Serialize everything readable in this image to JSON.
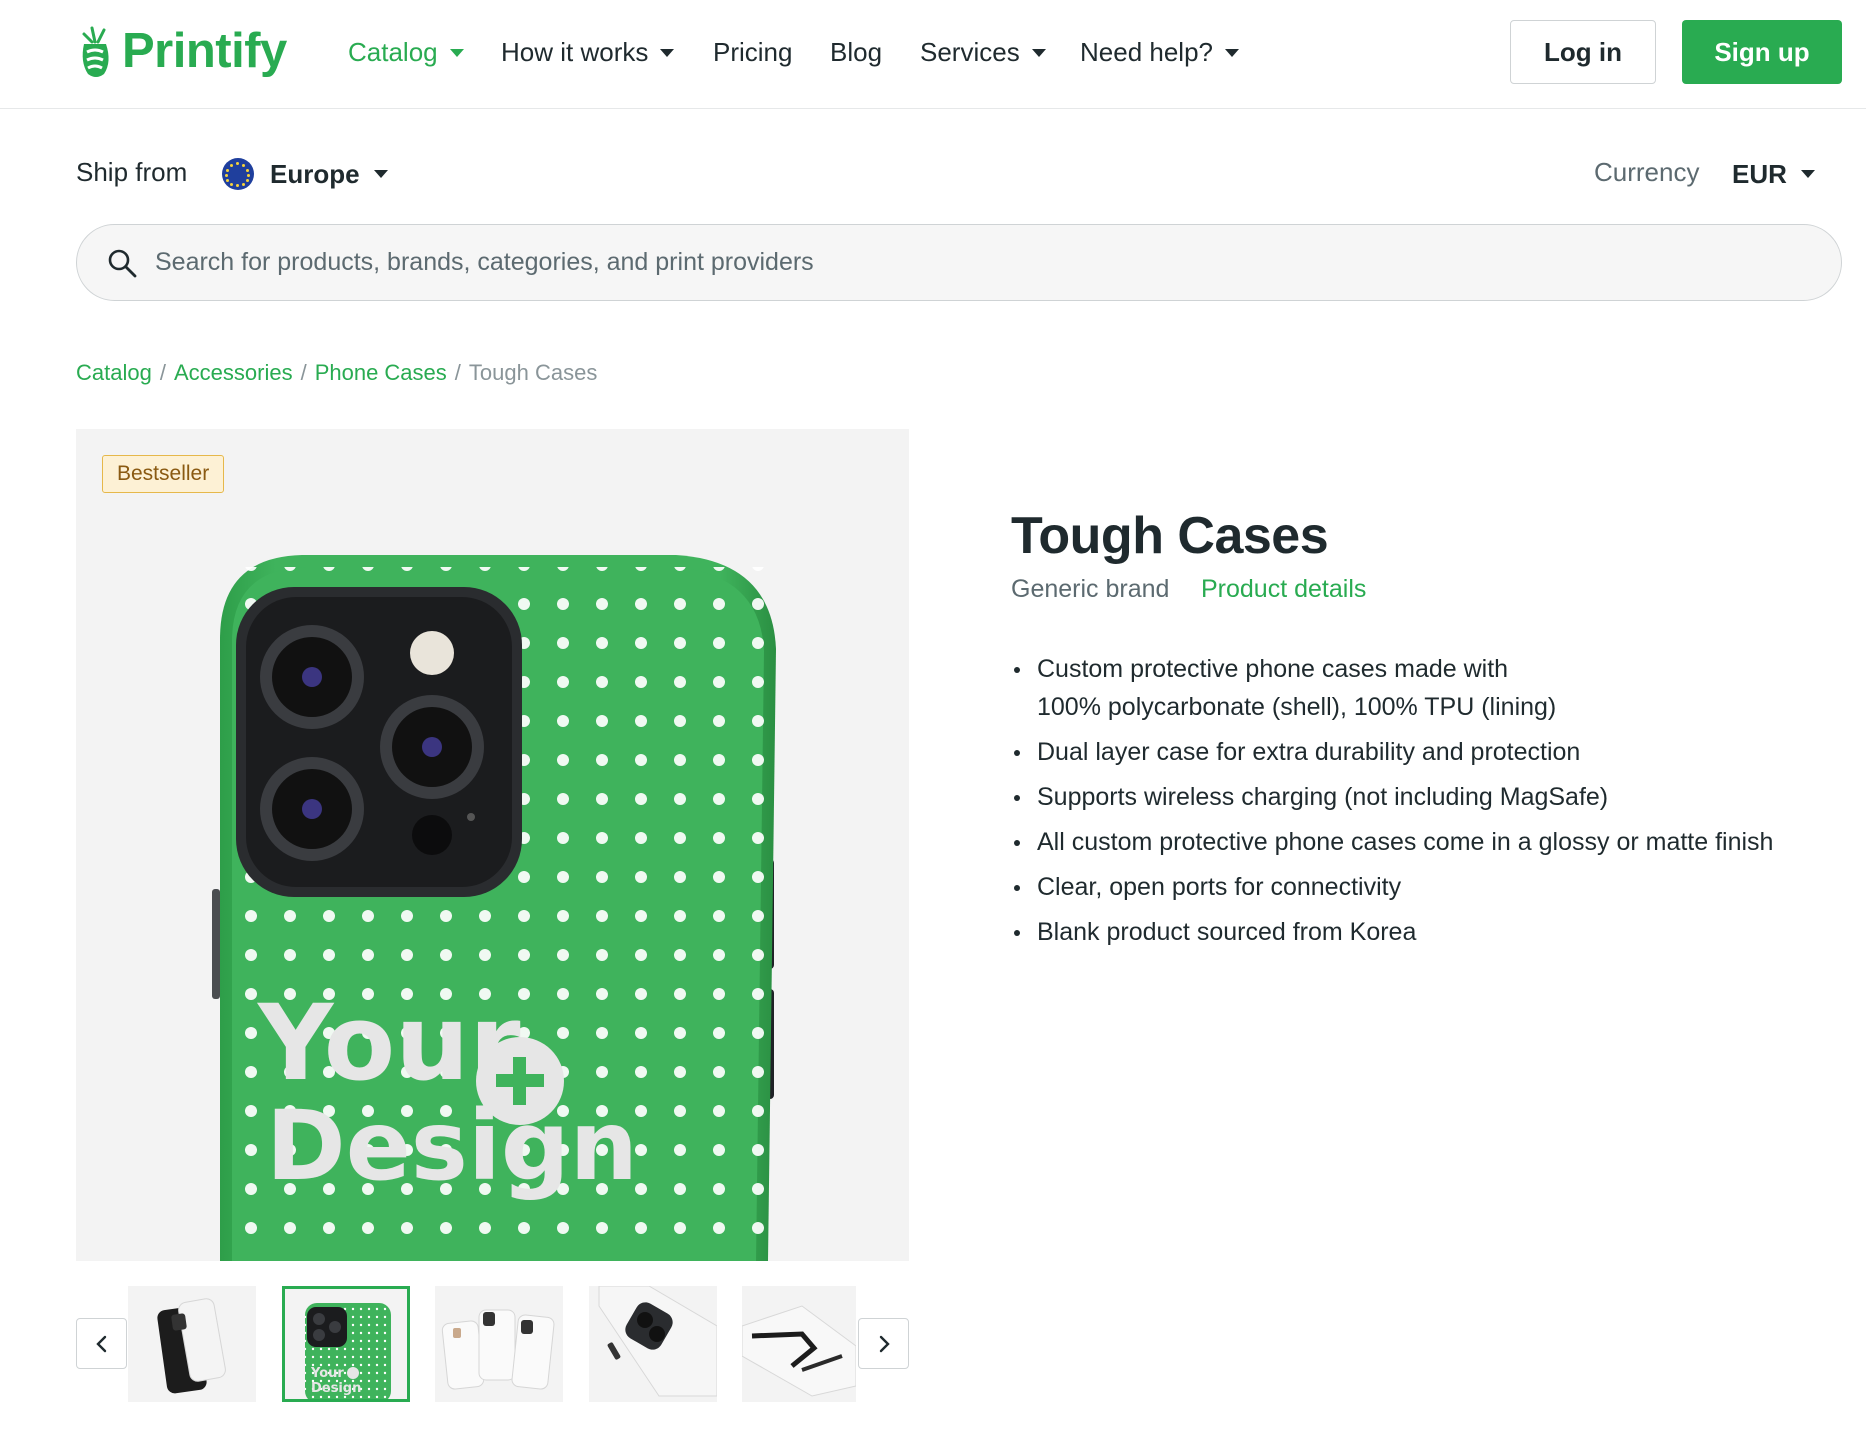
{
  "header": {
    "logo_text": "Printify",
    "nav": [
      {
        "label": "Catalog",
        "active": true,
        "dropdown": true
      },
      {
        "label": "How it works",
        "active": false,
        "dropdown": true
      },
      {
        "label": "Pricing",
        "active": false,
        "dropdown": false
      },
      {
        "label": "Blog",
        "active": false,
        "dropdown": false
      },
      {
        "label": "Services",
        "active": false,
        "dropdown": true
      },
      {
        "label": "Need help?",
        "active": false,
        "dropdown": true
      }
    ],
    "login_label": "Log in",
    "signup_label": "Sign up"
  },
  "ship": {
    "label": "Ship from",
    "value": "Europe",
    "flag_icon": "eu-flag-icon"
  },
  "currency": {
    "label": "Currency",
    "value": "EUR"
  },
  "search": {
    "placeholder": "Search for products, brands, categories, and print providers",
    "value": ""
  },
  "breadcrumb": {
    "items": [
      "Catalog",
      "Accessories",
      "Phone Cases"
    ],
    "current": "Tough Cases",
    "separator": "/"
  },
  "gallery": {
    "badge": "Bestseller",
    "main_overlay_line1": "Your",
    "main_overlay_line2": "Design",
    "thumb_overlay_line1": "Your",
    "thumb_overlay_line2": "Design",
    "selected_index": 1,
    "thumb_count": 5
  },
  "product": {
    "title": "Tough Cases",
    "brand": "Generic brand",
    "details_link": "Product details",
    "features": [
      "Custom protective phone cases made with 100% polycarbonate (shell), 100% TPU (lining)",
      "Dual layer case for extra durability and protection",
      "Supports wireless charging (not including MagSafe)",
      "All custom protective phone cases come in a glossy or matte finish",
      "Clear, open ports for connectivity",
      "Blank product sourced from Korea"
    ]
  },
  "colors": {
    "brand_green": "#29ab51",
    "text_dark": "#1f2a2e",
    "badge_bg": "#fdf1d5"
  }
}
